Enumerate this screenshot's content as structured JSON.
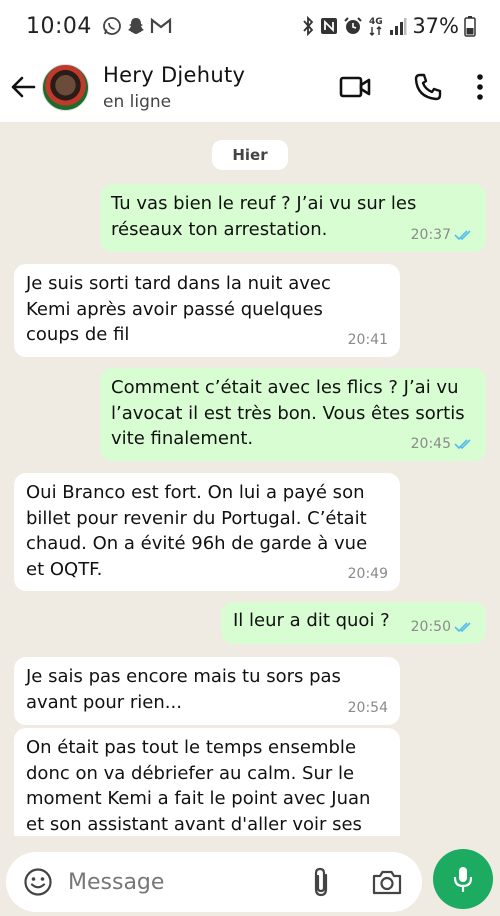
{
  "status_bar": {
    "time": "10:04",
    "battery": "37%",
    "network": "4G"
  },
  "header": {
    "contact_name": "Hery Djehuty",
    "contact_status": "en ligne"
  },
  "chat": {
    "date_chip": "Hier",
    "messages": [
      {
        "direction": "out",
        "text": "Tu vas bien le reuf ? J’ai vu sur les réseaux ton arrestation.",
        "time": "20:37",
        "read": true
      },
      {
        "direction": "in",
        "text": "Je suis sorti tard dans la nuit avec Kemi après avoir passé quelques coups de fil",
        "time": "20:41"
      },
      {
        "direction": "out",
        "text": "Comment c’était avec les flics ? J’ai vu l’avocat il est très bon. Vous êtes sortis vite finalement.",
        "time": "20:45",
        "read": true
      },
      {
        "direction": "in",
        "text": "Oui Branco est fort. On lui a payé son billet pour revenir du Portugal. C’était chaud. On a évité 96h de garde à vue et OQTF.",
        "time": "20:49"
      },
      {
        "direction": "out",
        "text": "Il leur a dit quoi ?",
        "time": "20:50",
        "read": true
      },
      {
        "direction": "in",
        "text": "Je sais pas encore mais tu sors pas avant pour rien...",
        "time": "20:54"
      },
      {
        "direction": "in",
        "text": "On était pas tout le temps ensemble donc on va débriefer au calm. Sur le moment Kemi a fait le point avec Juan et son assistant avant d'aller voir ses",
        "time": ""
      }
    ]
  },
  "composer": {
    "placeholder": "Message"
  },
  "colors": {
    "outgoing_bubble": "#d9fdd3",
    "incoming_bubble": "#ffffff",
    "chat_background": "#efeae2",
    "read_ticks": "#53bdeb",
    "mic_button": "#1daa61"
  },
  "icons": [
    "back-arrow-icon",
    "video-call-icon",
    "phone-icon",
    "more-options-icon",
    "emoji-icon",
    "attach-icon",
    "camera-icon",
    "mic-icon",
    "double-check-icon"
  ]
}
